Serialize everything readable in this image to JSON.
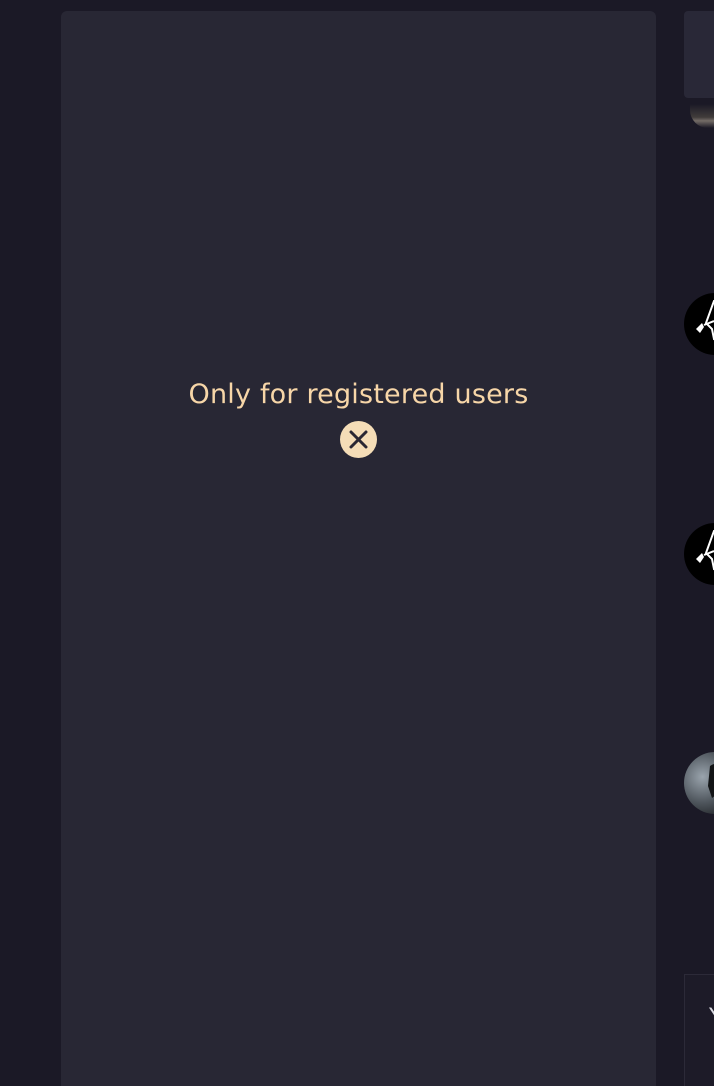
{
  "main": {
    "restricted_message": "Only for registered users"
  },
  "icons": {
    "close": "close-icon"
  },
  "colors": {
    "page_background": "#1b1926",
    "panel_background": "#282734",
    "message_text": "#f7d6a8",
    "close_button": "#f5ddb7"
  },
  "right_column": {
    "footer_glyph": "Y"
  }
}
